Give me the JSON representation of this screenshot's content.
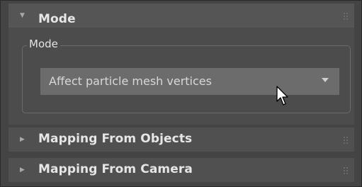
{
  "rollouts": [
    {
      "title": "Mode",
      "expanded": true,
      "arrow_icon": "triangle-down-icon"
    },
    {
      "title": "Mapping From Objects",
      "expanded": false,
      "arrow_icon": "triangle-right-icon"
    },
    {
      "title": "Mapping From Camera",
      "expanded": false,
      "arrow_icon": "triangle-right-icon"
    }
  ],
  "mode_group": {
    "label": "Mode",
    "dropdown": {
      "selected": "Affect particle mesh vertices",
      "arrow_icon": "chevron-down-icon"
    }
  },
  "arrows": {
    "down": "▼",
    "right": "▶"
  },
  "colors": {
    "panel_bg": "#444444",
    "rollout_header_bg": "#555555",
    "dropdown_bg": "#6c6c6c",
    "text": "#e6e6e6"
  }
}
